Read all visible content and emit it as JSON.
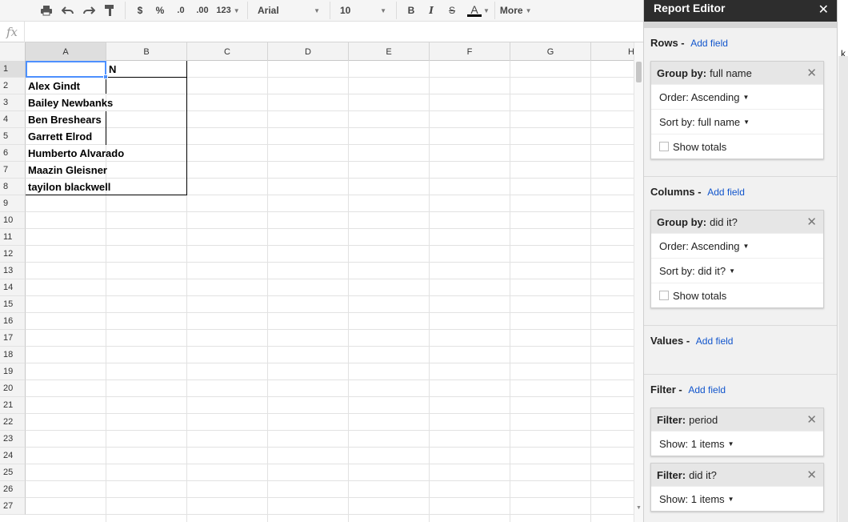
{
  "toolbar": {
    "currency": "$",
    "percent": "%",
    "decrease_decimal": ".0",
    "increase_decimal": ".00",
    "number_format": "123",
    "font": "Arial",
    "font_size": "10",
    "bold": "B",
    "italic": "I",
    "strike": "S",
    "text_color": "A",
    "more": "More"
  },
  "formula_bar": {
    "fx": "fx",
    "value": ""
  },
  "columns": [
    "A",
    "B",
    "C",
    "D",
    "E",
    "F",
    "G",
    "H"
  ],
  "rows": [
    "1",
    "2",
    "3",
    "4",
    "5",
    "6",
    "7",
    "8",
    "9",
    "10",
    "11",
    "12",
    "13",
    "14",
    "15",
    "16",
    "17",
    "18",
    "19",
    "20",
    "21",
    "22",
    "23",
    "24",
    "25",
    "26",
    "27"
  ],
  "cells": {
    "B1": "N",
    "A2": "Alex Gindt",
    "A3": "Bailey Newbanks",
    "A4": "Ben Breshears",
    "A5": "Garrett Elrod",
    "A6": "Humberto Alvarado",
    "A7": "Maazin Gleisner",
    "A8": "tayilon blackwell"
  },
  "report_editor": {
    "title": "Report Editor",
    "close": "✕",
    "add_field": "Add field",
    "rows": {
      "title": "Rows",
      "group_label": "Group by:",
      "group_value": "full name",
      "order": "Order: Ascending",
      "sort": "Sort by: full name",
      "totals": "Show totals"
    },
    "columns": {
      "title": "Columns",
      "group_label": "Group by:",
      "group_value": "did it?",
      "order": "Order: Ascending",
      "sort": "Sort by: did it?",
      "totals": "Show totals"
    },
    "values": {
      "title": "Values"
    },
    "filter": {
      "title": "Filter",
      "items": [
        {
          "label": "Filter:",
          "value": "period",
          "show": "Show: 1 items"
        },
        {
          "label": "Filter:",
          "value": "did it?",
          "show": "Show: 1 items"
        }
      ]
    }
  },
  "edge_letter": "k",
  "colors": {
    "selection": "#4d90fe",
    "link": "#1155cc",
    "panel_header": "#2d2d2d"
  }
}
